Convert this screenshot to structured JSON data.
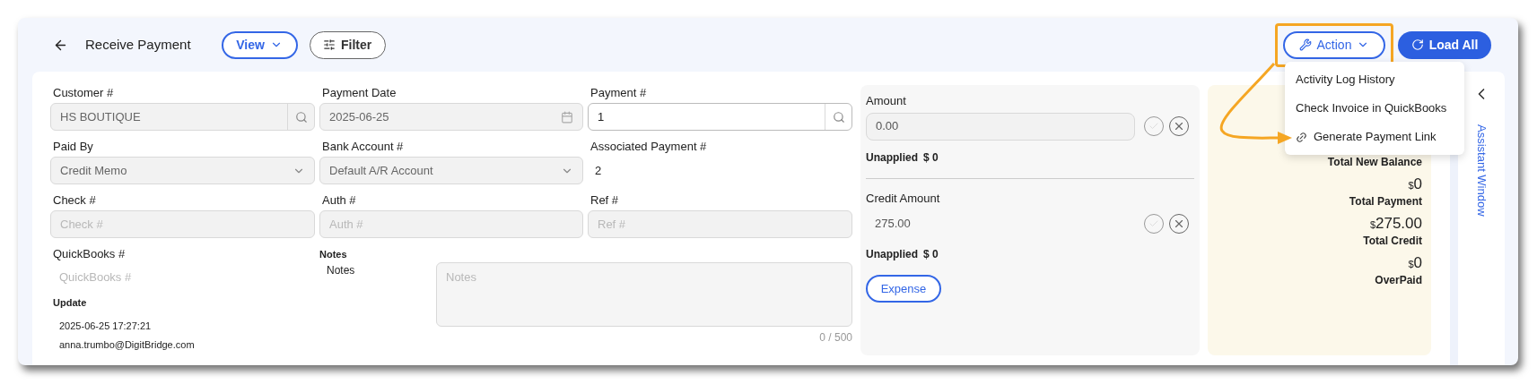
{
  "header": {
    "title": "Receive Payment",
    "view_button": "View",
    "filter_button": "Filter",
    "action_button": "Action",
    "load_all_button": "Load All",
    "action_highlighted": true
  },
  "action_menu": {
    "open": true,
    "items": [
      {
        "label": "Activity Log History",
        "kind": "text"
      },
      {
        "label": "Check Invoice in QuickBooks",
        "kind": "text"
      },
      {
        "label": "Generate Payment Link",
        "kind": "link"
      }
    ]
  },
  "form_rows": [
    [
      {
        "label": "Customer #",
        "kind": "search",
        "value": "HS BOUTIQUE",
        "disabled": true
      },
      {
        "label": "Payment Date",
        "kind": "date",
        "value": "2025-06-25",
        "disabled": true
      },
      {
        "label": "Payment #",
        "kind": "search",
        "value": "1",
        "disabled": false
      }
    ],
    [
      {
        "label": "Paid By",
        "kind": "select",
        "value": "Credit Memo",
        "disabled": true
      },
      {
        "label": "Bank Account #",
        "kind": "select",
        "value": "Default A/R Account",
        "disabled": true
      },
      {
        "label": "Associated Payment #",
        "kind": "static",
        "value": "2"
      }
    ],
    [
      {
        "label": "Check #",
        "kind": "text",
        "placeholder": "Check #",
        "disabled": true
      },
      {
        "label": "Auth #",
        "kind": "text",
        "placeholder": "Auth #",
        "disabled": true
      },
      {
        "label": "Ref #",
        "kind": "text",
        "placeholder": "Ref #",
        "disabled": true
      }
    ]
  ],
  "quickbooks": {
    "label": "QuickBooks #",
    "placeholder": "QuickBooks #"
  },
  "update": {
    "label": "Update",
    "time": "2025-06-25 17:27:21",
    "user": "anna.trumbo@DigitBridge.com"
  },
  "notes": {
    "label": "Notes",
    "sublabel": "Notes",
    "placeholder": "Notes",
    "counter": "0 / 500"
  },
  "amounts": [
    {
      "label": "Amount",
      "value": "0.00",
      "bordered": true,
      "unapplied_label": "Unapplied",
      "unapplied": "$ 0"
    },
    {
      "label": "Credit Amount",
      "value": "275.00",
      "bordered": false,
      "unapplied_label": "Unapplied",
      "unapplied": "$ 0"
    }
  ],
  "expense_button": "Expense",
  "summary": [
    {
      "label": "Total New Balance"
    },
    {
      "currency": "$",
      "value": "0",
      "label": "Total Payment"
    },
    {
      "currency": "$",
      "value": "275.00",
      "label": "Total Credit"
    },
    {
      "currency": "$",
      "value": "0",
      "label": "OverPaid"
    }
  ],
  "assistant": {
    "label": "Assistant Window"
  }
}
